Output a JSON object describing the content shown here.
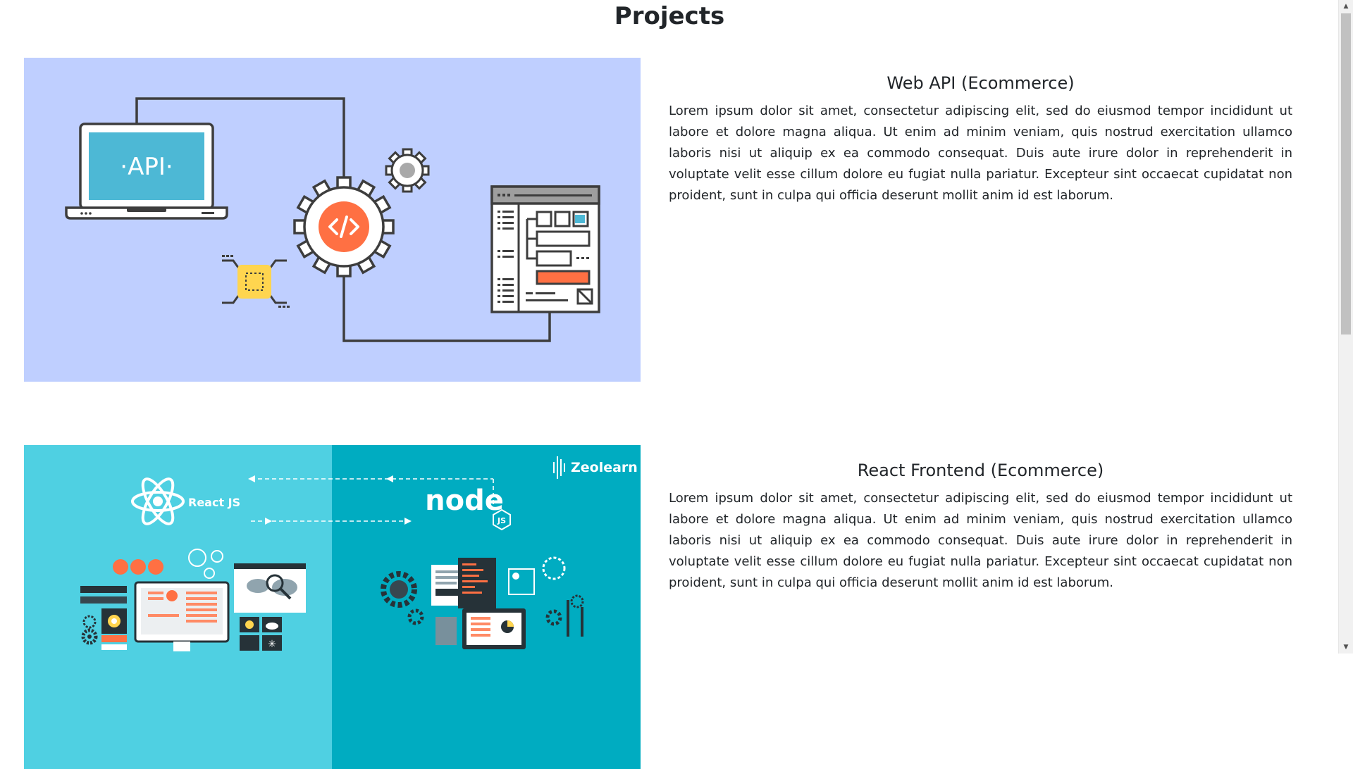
{
  "page": {
    "title": "Projects"
  },
  "projects": [
    {
      "title": "Web API (Ecommerce)",
      "description": "Lorem ipsum dolor sit amet, consectetur adipiscing elit, sed do eiusmod tempor incididunt ut labore et dolore magna aliqua. Ut enim ad minim veniam, quis nostrud exercitation ullamco laboris nisi ut aliquip ex ea commodo consequat. Duis aute irure dolor in reprehenderit in voluptate velit esse cillum dolore eu fugiat nulla pariatur. Excepteur sint occaecat cupidatat non proident, sunt in culpa qui officia deserunt mollit anim id est laborum.",
      "image_text": {
        "laptop": "·API·"
      }
    },
    {
      "title": "React Frontend (Ecommerce)",
      "description": "Lorem ipsum dolor sit amet, consectetur adipiscing elit, sed do eiusmod tempor incididunt ut labore et dolore magna aliqua. Ut enim ad minim veniam, quis nostrud exercitation ullamco laboris nisi ut aliquip ex ea commodo consequat. Duis aute irure dolor in reprehenderit in voluptate velit esse cillum dolore eu fugiat nulla pariatur. Excepteur sint occaecat cupidatat non proident, sunt in culpa qui officia deserunt mollit anim id est laborum.",
      "image_text": {
        "brand": "Zeolearn",
        "react": "React JS",
        "node": "node",
        "js_badge": "JS"
      }
    }
  ],
  "colors": {
    "api_bg": "#bfcfff",
    "react_left_bg": "#4fd0e2",
    "react_right_bg": "#00acc1",
    "accent_orange": "#ff7043",
    "accent_yellow": "#ffd54f",
    "line_dark": "#3d3d3d"
  },
  "icons": [
    "laptop-icon",
    "gear-icon",
    "code-icon",
    "chip-icon",
    "browser-window-icon",
    "react-atom-icon",
    "nodejs-logo-icon",
    "zeolearn-logo-icon"
  ]
}
